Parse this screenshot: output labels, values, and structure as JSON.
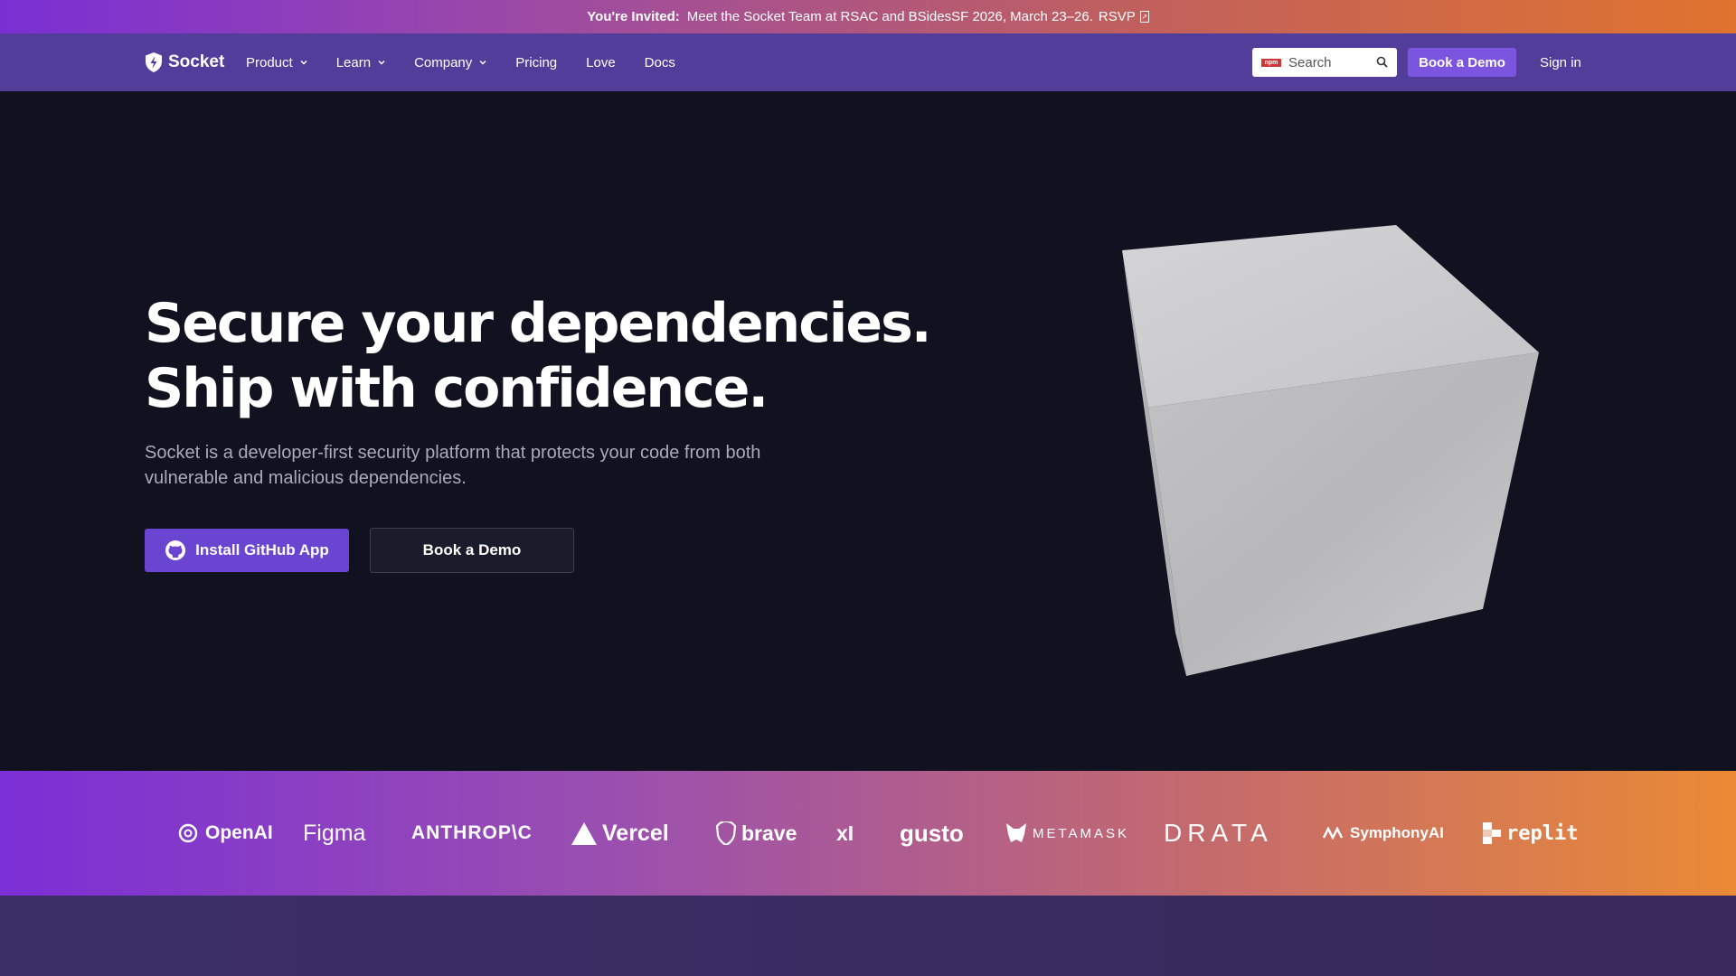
{
  "announcement": {
    "lead": "You're Invited:",
    "text": "Meet the Socket Team at RSAC and BSidesSF 2026, March 23–26.",
    "link": "RSVP"
  },
  "nav": {
    "brand": "Socket",
    "items": [
      {
        "label": "Product",
        "dropdown": true
      },
      {
        "label": "Learn",
        "dropdown": true
      },
      {
        "label": "Company",
        "dropdown": true
      },
      {
        "label": "Pricing",
        "dropdown": false
      },
      {
        "label": "Love",
        "dropdown": false
      },
      {
        "label": "Docs",
        "dropdown": false
      }
    ],
    "search_badge": "npm",
    "search_placeholder": "Search",
    "demo_label": "Book a Demo",
    "signin_label": "Sign in"
  },
  "hero": {
    "title_line1": "Secure your dependencies.",
    "title_line2": "Ship with confidence.",
    "subtitle": "Socket is a developer-first security platform that protects your code from both vulnerable and malicious dependencies.",
    "primary_cta": "Install GitHub App",
    "secondary_cta": "Book a Demo"
  },
  "customers": [
    "OpenAI",
    "Figma",
    "ANTHROP\\C",
    "Vercel",
    "brave",
    "xI",
    "gusto",
    "METAMASK",
    "DRATA",
    "SymphonyAI",
    "replit"
  ],
  "colors": {
    "accent": "#6a45d1",
    "nav_bg": "#523d9b",
    "page_bg": "#11121f"
  }
}
